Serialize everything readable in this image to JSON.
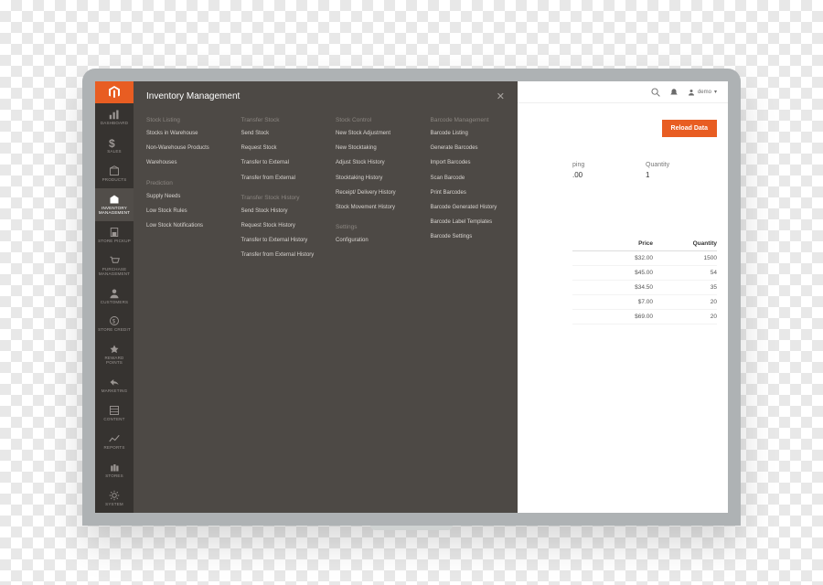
{
  "mega_title": "Inventory Management",
  "sidebar": [
    {
      "label": "Dashboard"
    },
    {
      "label": "Sales"
    },
    {
      "label": "Products"
    },
    {
      "label": "Inventory Management"
    },
    {
      "label": "Store Pickup"
    },
    {
      "label": "Purchase Management"
    },
    {
      "label": "Customers"
    },
    {
      "label": "Store Credit"
    },
    {
      "label": "Reward Points"
    },
    {
      "label": "Marketing"
    },
    {
      "label": "Content"
    },
    {
      "label": "Reports"
    },
    {
      "label": "Stores"
    },
    {
      "label": "System"
    }
  ],
  "columns": {
    "c1": {
      "title1": "Stock Listing",
      "items1": [
        "Stocks in Warehouse",
        "Non-Warehouse Products",
        "Warehouses"
      ],
      "title2": "Prediction",
      "items2": [
        "Supply Needs",
        "Low Stock Rules",
        "Low Stock Notifications"
      ]
    },
    "c2": {
      "title1": "Transfer Stock",
      "items1": [
        "Send Stock",
        "Request Stock",
        "Transfer to External",
        "Transfer from External"
      ],
      "title2": "Transfer Stock History",
      "items2": [
        "Send Stock History",
        "Request Stock History",
        "Transfer to External History",
        "Transfer from External History"
      ]
    },
    "c3": {
      "title1": "Stock Control",
      "items1": [
        "New Stock Adjustment",
        "New Stocktaking",
        "Adjust Stock History",
        "Stocktaking History",
        "Receipt/ Delivery History",
        "Stock Movement History"
      ],
      "title2": "Settings",
      "items2": [
        "Configuration"
      ]
    },
    "c4": {
      "title1": "Barcode Management",
      "items1": [
        "Barcode Listing",
        "Generate Barcodes",
        "Import Barcodes",
        "Scan Barcode",
        "Print Barcodes",
        "Barcode Generated History",
        "Barcode Label Templates",
        "Barcode Settings"
      ]
    }
  },
  "topbar": {
    "user": "demo"
  },
  "button_reload": "Reload Data",
  "summary": {
    "label1": "ping",
    "val1": ".00",
    "label2": "Quantity",
    "val2": "1"
  },
  "table": {
    "h_price": "Price",
    "h_qty": "Quantity",
    "rows": [
      {
        "price": "$32.00",
        "qty": "1500"
      },
      {
        "price": "$45.00",
        "qty": "54"
      },
      {
        "price": "$34.50",
        "qty": "35"
      },
      {
        "price": "$7.00",
        "qty": "20"
      },
      {
        "price": "$69.00",
        "qty": "20"
      }
    ]
  }
}
